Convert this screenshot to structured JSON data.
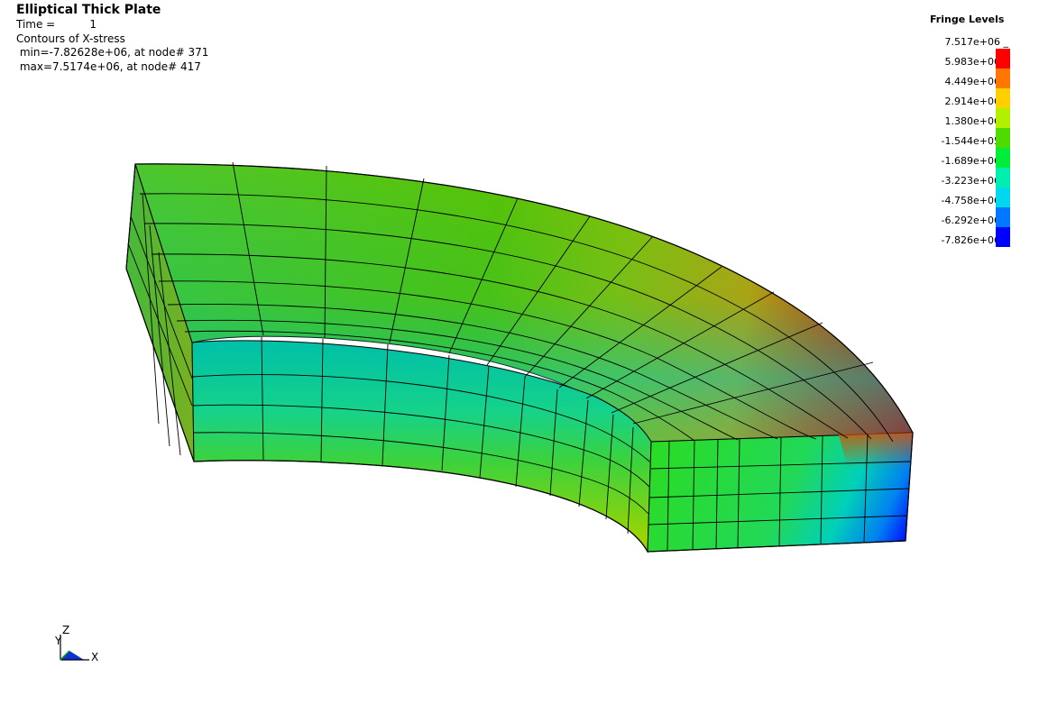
{
  "header": {
    "title": "Elliptical Thick Plate",
    "time_label": "Time =",
    "time_value": "1",
    "subtitle": "Contours of X-stress",
    "min_line": " min=-7.82628e+06, at node# 371",
    "max_line": " max=7.5174e+06, at node# 417"
  },
  "legend": {
    "title": "Fringe Levels",
    "levels": [
      "7.517e+06",
      "5.983e+06",
      "4.449e+06",
      "2.914e+06",
      "1.380e+06",
      "-1.544e+05",
      "-1.689e+06",
      "-3.223e+06",
      "-4.758e+06",
      "-6.292e+06",
      "-7.826e+06"
    ],
    "colors": [
      "#ff0000",
      "#ff7700",
      "#ffd000",
      "#b2ef00",
      "#4edc00",
      "#00ee3a",
      "#00eeb0",
      "#00d8ee",
      "#0078ff",
      "#0000ff"
    ]
  },
  "axes": {
    "x": "X",
    "y": "Y",
    "z": "Z"
  }
}
